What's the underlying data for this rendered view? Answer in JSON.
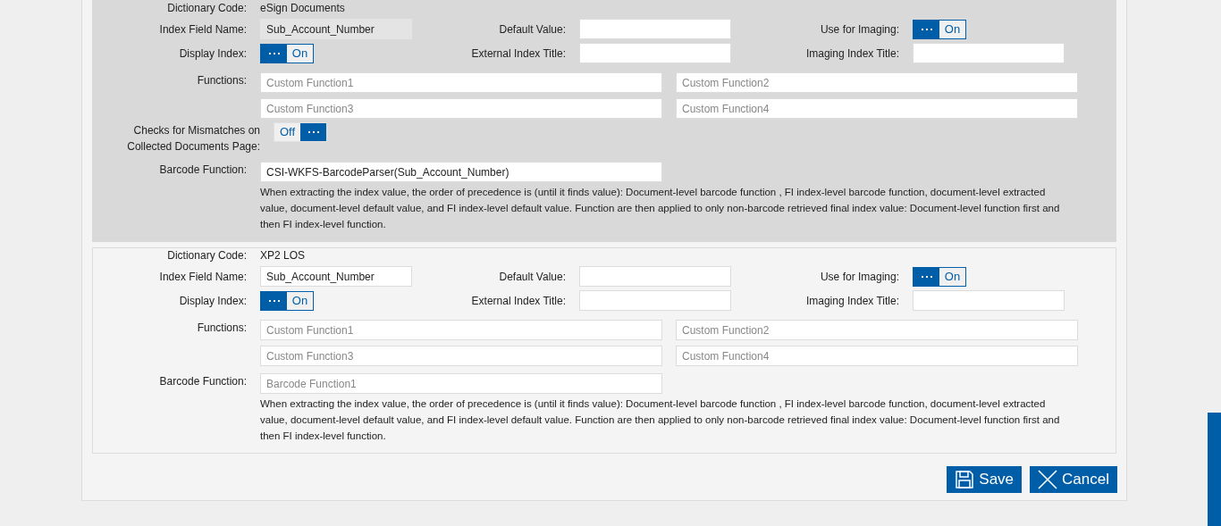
{
  "sections": [
    {
      "highlighted": true,
      "dictionary_code": {
        "label": "Dictionary Code:",
        "value": "eSign Documents"
      },
      "index_field_name": {
        "label": "Index Field Name:",
        "value": "Sub_Account_Number",
        "disabled": true
      },
      "default_value": {
        "label": "Default Value:"
      },
      "use_for_imaging": {
        "label": "Use for Imaging:",
        "on": true,
        "state_text": "On"
      },
      "display_index": {
        "label": "Display Index:",
        "on": true,
        "state_text": "On"
      },
      "external_index_title": {
        "label": "External Index Title:"
      },
      "imaging_index_title": {
        "label": "Imaging Index Title:"
      },
      "functions": {
        "label": "Functions:",
        "fields": [
          {
            "placeholder": "Custom Function1"
          },
          {
            "placeholder": "Custom Function2"
          },
          {
            "placeholder": "Custom Function3"
          },
          {
            "placeholder": "Custom Function4"
          }
        ]
      },
      "mismatch_check": {
        "label": "Checks for Mismatches on Collected Documents Page:",
        "on": false,
        "state_text": "Off"
      },
      "barcode_function": {
        "label": "Barcode Function:",
        "value": "CSI-WKFS-BarcodeParser(Sub_Account_Number)"
      },
      "help_text": "When extracting the index value, the order of precedence is (until it finds value): Document-level barcode function , FI index-level barcode function, document-level extracted value, document-level default value, and FI index-level default value. Function are then applied to only non-barcode retrieved final index value: Document-level function first and then FI index-level function."
    },
    {
      "highlighted": false,
      "dictionary_code": {
        "label": "Dictionary Code:",
        "value": "XP2 LOS"
      },
      "index_field_name": {
        "label": "Index Field Name:",
        "value": "Sub_Account_Number",
        "disabled": false
      },
      "default_value": {
        "label": "Default Value:"
      },
      "use_for_imaging": {
        "label": "Use for Imaging:",
        "on": true,
        "state_text": "On"
      },
      "display_index": {
        "label": "Display Index:",
        "on": true,
        "state_text": "On"
      },
      "external_index_title": {
        "label": "External Index Title:"
      },
      "imaging_index_title": {
        "label": "Imaging Index Title:"
      },
      "functions": {
        "label": "Functions:",
        "fields": [
          {
            "placeholder": "Custom Function1"
          },
          {
            "placeholder": "Custom Function2"
          },
          {
            "placeholder": "Custom Function3"
          },
          {
            "placeholder": "Custom Function4"
          }
        ]
      },
      "barcode_function": {
        "label": "Barcode Function:",
        "placeholder": "Barcode Function1"
      },
      "help_text": "When extracting the index value, the order of precedence is (until it finds value): Document-level barcode function , FI index-level barcode function, document-level extracted value, document-level default value, and FI index-level default value. Function are then applied to only non-barcode retrieved final index value: Document-level function first and then FI index-level function."
    }
  ],
  "buttons": [
    {
      "kind": "save",
      "label": "Save"
    },
    {
      "kind": "cancel",
      "label": "Cancel"
    }
  ]
}
